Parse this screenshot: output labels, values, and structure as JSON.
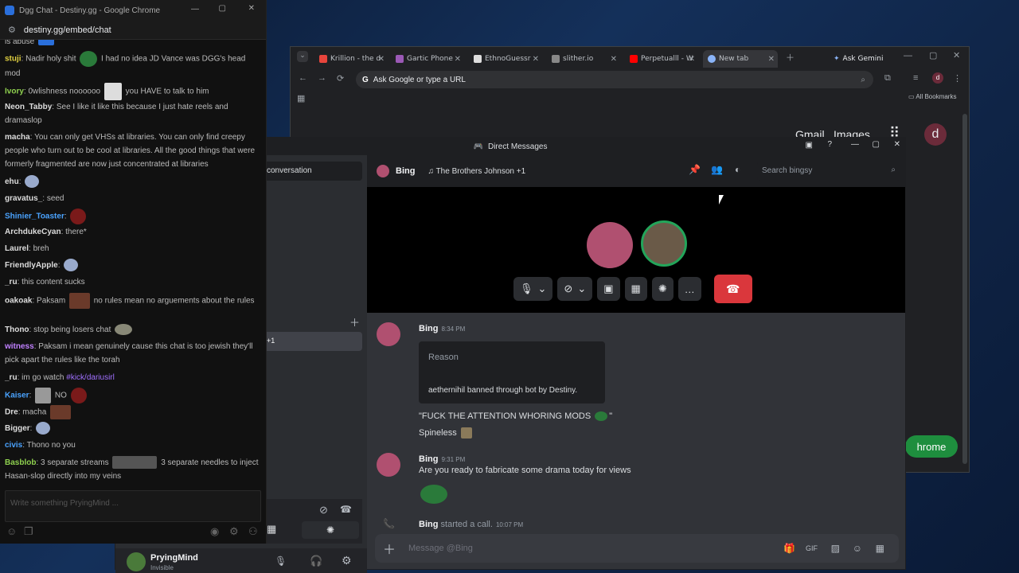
{
  "chrome": {
    "tabs": [
      {
        "label": "Krillion - the d",
        "color": "#e8453c"
      },
      {
        "label": "Gartic Phone",
        "color": "#9b59b6"
      },
      {
        "label": "EthnoGuessr",
        "color": "#dddddd"
      },
      {
        "label": "slither.io",
        "color": "#888888"
      },
      {
        "label": "Perpetualll - W",
        "color": "#ff0000"
      },
      {
        "label": "New tab",
        "color": "#8ab4f8"
      }
    ],
    "ask_gemini": "Ask Gemini",
    "omnibox_placeholder": "Ask Google or type a URL",
    "bookmarks": "All Bookmarks",
    "gmail": "Gmail",
    "images": "Images",
    "profile_letter": "d",
    "chrome_pill": "hrome"
  },
  "discord": {
    "window_title": "Direct Messages",
    "sidebar_conversation": "conversation",
    "sidebar_dm_suffix": "+1",
    "user": {
      "name": "PryingMind",
      "status": "Invisible"
    },
    "header": {
      "name": "Bing",
      "activity": "The Brothers Johnson +1",
      "search_placeholder": "Search bingsy"
    },
    "messages": [
      {
        "author": "Bing",
        "time": "8:34 PM",
        "embed_title": "Reason",
        "embed_text": "aethernihil banned through bot by Destiny.",
        "lines": [
          "\"FUCK THE ATTENTION WHORING MODS",
          "Spineless"
        ]
      },
      {
        "author": "Bing",
        "time": "9:31 PM",
        "text": "Are you ready to fabricate some drama today for views"
      }
    ],
    "call_notice": {
      "author": "Bing",
      "text": "started a call.",
      "time": "10:07 PM"
    },
    "message_placeholder": "Message @Bing"
  },
  "chat": {
    "window_title": "Dgg Chat - Destiny.gg - Google Chrome",
    "url": "destiny.gg/embed/chat",
    "lines": [
      {
        "nick": "",
        "text": "is abuse",
        "color": "#aaa"
      },
      {
        "nick": "stuji",
        "text": "Nadir holy shit",
        "text2": "I had no idea JD Vance was DGG's head mod",
        "color": "#e0d040"
      },
      {
        "nick": "Ivory",
        "text": "0wlishness noooooo",
        "text2": "you HAVE to talk to him",
        "color": "#8fd14f"
      },
      {
        "nick": "Neon_Tabby",
        "text": "See I like it like this because I just hate reels and dramaslop",
        "color": "#dddddd"
      },
      {
        "nick": "macha",
        "text": "You can only get VHSs at libraries. You can only find creepy people who turn out to be cool at libraries. All the good things that were formerly fragmented are now just concentrated at libraries",
        "color": "#dddddd"
      },
      {
        "nick": "ehu",
        "text": "",
        "color": "#dddddd"
      },
      {
        "nick": "gravatus_",
        "text": "seed",
        "color": "#dddddd"
      },
      {
        "nick": "Shinier_Toaster",
        "text": "",
        "color": "#4aa3ff"
      },
      {
        "nick": "ArchdukeCyan",
        "text": "there*",
        "color": "#dddddd"
      },
      {
        "nick": "Laurel",
        "text": "breh",
        "color": "#dddddd"
      },
      {
        "nick": "FriendlyApple",
        "text": "",
        "color": "#dddddd"
      },
      {
        "nick": "_ru",
        "text": "this content sucks",
        "color": "#dddddd"
      },
      {
        "nick": "oakoak",
        "text": "Paksam",
        "text2": "no rules mean no arguements about the rules",
        "color": "#dddddd"
      },
      {
        "nick": "Thono",
        "text": "stop being losers chat",
        "color": "#dddddd"
      },
      {
        "nick": "witness",
        "text": "Paksam i mean genuinely cause this chat is too jewish they'll pick apart the rules like the torah",
        "color": "#c080ff"
      },
      {
        "nick": "_ru",
        "text": "im go watch",
        "link": "#kick/dariusirl",
        "color": "#dddddd"
      },
      {
        "nick": "Kaiser",
        "text": "NO",
        "color": "#4aa3ff"
      },
      {
        "nick": "Dre",
        "text": "macha",
        "color": "#dddddd"
      },
      {
        "nick": "Bigger",
        "text": "",
        "color": "#dddddd"
      },
      {
        "nick": "civis",
        "text": "Thono no you",
        "color": "#4aa3ff"
      },
      {
        "nick": "Basblob",
        "text": "3 separate streams",
        "text2": "3 separate needles to inject Hasan-slop directly into my veins",
        "color": "#8fd14f"
      }
    ],
    "input_placeholder": "Write something PryingMind ..."
  }
}
